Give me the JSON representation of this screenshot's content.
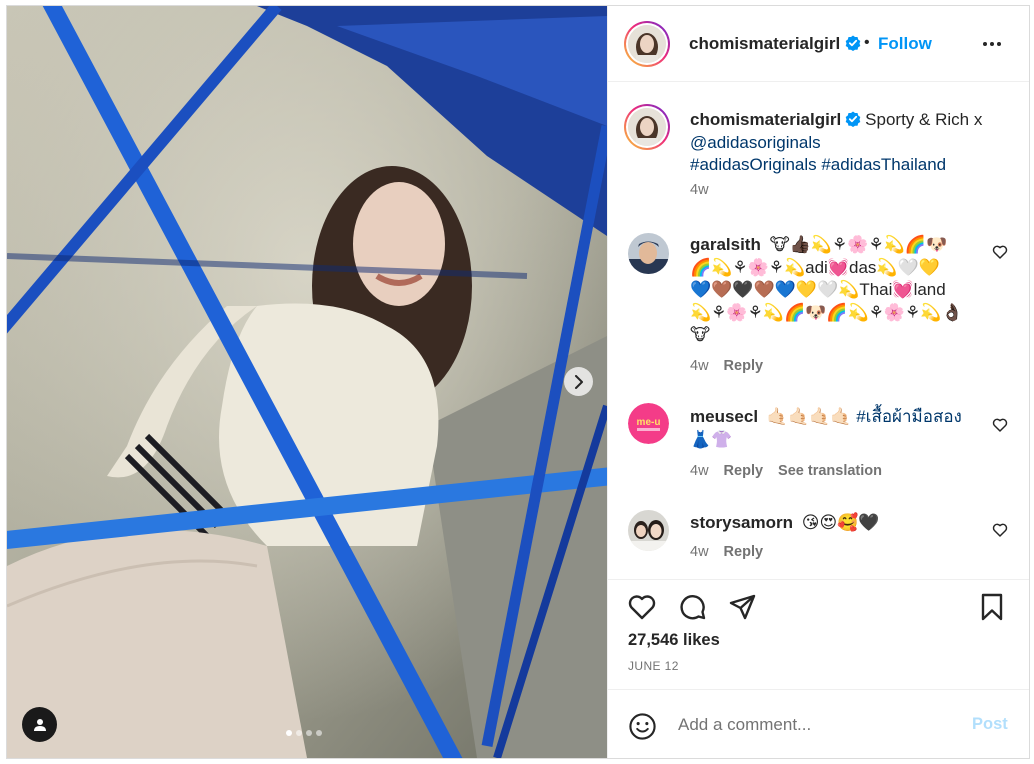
{
  "post": {
    "username": "chomismaterialgirl",
    "follow_label": "Follow",
    "caption_text": "Sporty & Rich x",
    "caption_mention": "@adidasoriginals",
    "caption_hashtags": "#adidasOriginals #adidasThailand",
    "caption_age": "4w",
    "likes": "27,546 likes",
    "date": "JUNE 12"
  },
  "comments": [
    {
      "username": "garalsith",
      "lines": [
        "🐮👍🏿💫⚘🌸⚘💫🌈🐶",
        "🌈💫⚘🌸⚘💫adi💓das💫🤍💛",
        "💙🤎🖤🤎💙💛🤍💫Thai💓land",
        "💫⚘🌸⚘💫🌈🐶🌈💫⚘🌸⚘💫👌🏿",
        "🐮"
      ],
      "age": "4w",
      "reply_label": "Reply"
    },
    {
      "username": "meusecl",
      "emoji_prefix": "🤙🏻🤙🏻🤙🏻🤙🏻",
      "hashtag": "#เสื้อผ้ามือสอง",
      "line2": "👗👚",
      "age": "4w",
      "reply_label": "Reply",
      "translation_label": "See translation"
    },
    {
      "username": "storysamorn",
      "text": "😘😍🥰🖤",
      "age": "4w",
      "reply_label": "Reply"
    }
  ],
  "composer": {
    "placeholder": "Add a comment...",
    "post_label": "Post"
  },
  "icons": {
    "verified": "verified-badge-icon",
    "heart": "heart-icon",
    "comment": "comment-icon",
    "share": "share-icon",
    "save": "bookmark-icon",
    "emoji": "emoji-icon",
    "next": "chevron-right-icon",
    "tag": "user-tag-icon",
    "more": "more-horizontal-icon"
  },
  "carousel": {
    "total": 4,
    "active": 1
  },
  "colors": {
    "accent": "#0095f6",
    "link": "#00376b",
    "muted": "#737373",
    "post_disabled": "#b2dffc"
  }
}
